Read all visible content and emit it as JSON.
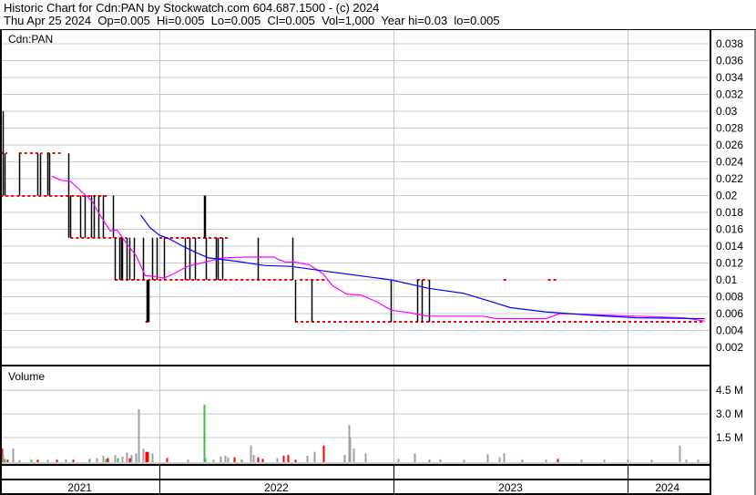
{
  "header": {
    "title": "Historic Chart for Cdn:PAN by Stockwatch.com 604.687.1500 - (c) 2024",
    "quote": "Thu Apr 25 2024  Op=0.005  Hi=0.005  Lo=0.005  Cl=0.005  Vol=1,000  Year hi=0.03  lo=0.005"
  },
  "colors": {
    "bar": "#000000",
    "close": "#ff0000",
    "ma_short": "#ff00ff",
    "ma_long": "#0000ff",
    "vol_up": "#44bb44",
    "vol_down": "#ff0000",
    "vol_flat": "#a0a0a0",
    "grid": "#c8c8c8"
  },
  "chart_data": [
    {
      "type": "line",
      "title": "Cdn:PAN",
      "ylim": [
        0,
        0.04
      ],
      "yticks": [
        "0.002",
        "0.004",
        "0.006",
        "0.008",
        "0.01",
        "0.012",
        "0.014",
        "0.016",
        "0.018",
        "0.02",
        "0.022",
        "0.024",
        "0.026",
        "0.028",
        "0.03",
        "0.032",
        "0.034",
        "0.036",
        "0.038"
      ],
      "xlim": [
        2021.32,
        2024.33
      ],
      "x_labels": [
        {
          "t": 2021.66,
          "label": "2021"
        },
        {
          "t": 2022.5,
          "label": "2022"
        },
        {
          "t": 2023.5,
          "label": "2023"
        },
        {
          "t": 2024.17,
          "label": "2024"
        }
      ],
      "year_boundaries": [
        2022,
        2023,
        2024
      ],
      "hl_bars": [
        [
          2021.33,
          0.02,
          0.03
        ],
        [
          2021.34,
          0.02,
          0.025
        ],
        [
          2021.4,
          0.02,
          0.025
        ],
        [
          2021.48,
          0.02,
          0.025
        ],
        [
          2021.49,
          0.02,
          0.025
        ],
        [
          2021.52,
          0.02,
          0.025
        ],
        [
          2021.53,
          0.02,
          0.025
        ],
        [
          2021.61,
          0.015,
          0.025
        ],
        [
          2021.62,
          0.015,
          0.02
        ],
        [
          2021.66,
          0.015,
          0.02
        ],
        [
          2021.68,
          0.015,
          0.02
        ],
        [
          2021.71,
          0.015,
          0.02
        ],
        [
          2021.72,
          0.015,
          0.02
        ],
        [
          2021.74,
          0.015,
          0.02
        ],
        [
          2021.76,
          0.015,
          0.02
        ],
        [
          2021.8,
          0.015,
          0.02
        ],
        [
          2021.81,
          0.01,
          0.015
        ],
        [
          2021.83,
          0.01,
          0.015
        ],
        [
          2021.835,
          0.01,
          0.015
        ],
        [
          2021.84,
          0.01,
          0.015
        ],
        [
          2021.86,
          0.01,
          0.015
        ],
        [
          2021.87,
          0.01,
          0.015
        ],
        [
          2021.89,
          0.01,
          0.015
        ],
        [
          2021.93,
          0.01,
          0.015
        ],
        [
          2021.945,
          0.005,
          0.01
        ],
        [
          2021.95,
          0.005,
          0.01
        ],
        [
          2021.955,
          0.005,
          0.01
        ],
        [
          2021.97,
          0.01,
          0.015
        ],
        [
          2021.99,
          0.01,
          0.015
        ],
        [
          2022.02,
          0.01,
          0.015
        ],
        [
          2022.11,
          0.01,
          0.015
        ],
        [
          2022.13,
          0.01,
          0.015
        ],
        [
          2022.15,
          0.01,
          0.015
        ],
        [
          2022.19,
          0.015,
          0.02
        ],
        [
          2022.195,
          0.015,
          0.02
        ],
        [
          2022.2,
          0.01,
          0.015
        ],
        [
          2022.24,
          0.01,
          0.015
        ],
        [
          2022.25,
          0.01,
          0.015
        ],
        [
          2022.27,
          0.01,
          0.015
        ],
        [
          2022.42,
          0.01,
          0.015
        ],
        [
          2022.57,
          0.01,
          0.015
        ],
        [
          2022.58,
          0.005,
          0.01
        ],
        [
          2022.65,
          0.005,
          0.01
        ],
        [
          2022.99,
          0.005,
          0.01
        ],
        [
          2023.1,
          0.005,
          0.01
        ],
        [
          2023.12,
          0.005,
          0.01
        ],
        [
          2023.15,
          0.005,
          0.01
        ]
      ],
      "close_runs": [
        [
          2021.32,
          2021.35,
          0.025
        ],
        [
          2021.4,
          2021.5,
          0.025
        ],
        [
          2021.52,
          2021.58,
          0.025
        ],
        [
          2021.32,
          2021.78,
          0.02
        ],
        [
          2021.62,
          2021.86,
          0.015
        ],
        [
          2022.0,
          2022.3,
          0.015
        ],
        [
          2021.81,
          2022.58,
          0.01
        ],
        [
          2022.6,
          2022.72,
          0.01
        ],
        [
          2023.1,
          2023.15,
          0.01
        ],
        [
          2023.47,
          2023.49,
          0.01
        ],
        [
          2023.66,
          2023.7,
          0.01
        ],
        [
          2021.94,
          2021.96,
          0.005
        ],
        [
          2022.58,
          2024.33,
          0.005
        ]
      ],
      "series": [
        {
          "name": "ma_short",
          "points": [
            [
              2021.54,
              0.0223
            ],
            [
              2021.58,
              0.0218
            ],
            [
              2021.62,
              0.0217
            ],
            [
              2021.67,
              0.0204
            ],
            [
              2021.71,
              0.0194
            ],
            [
              2021.75,
              0.0175
            ],
            [
              2021.79,
              0.0158
            ],
            [
              2021.82,
              0.0159
            ],
            [
              2021.86,
              0.0143
            ],
            [
              2021.9,
              0.0129
            ],
            [
              2021.94,
              0.0105
            ],
            [
              2021.98,
              0.0104
            ],
            [
              2022.02,
              0.0102
            ],
            [
              2022.06,
              0.0107
            ],
            [
              2022.12,
              0.0116
            ],
            [
              2022.18,
              0.012
            ],
            [
              2022.21,
              0.0122
            ],
            [
              2022.27,
              0.0126
            ],
            [
              2022.37,
              0.0127
            ],
            [
              2022.49,
              0.0127
            ],
            [
              2022.51,
              0.0124
            ],
            [
              2022.54,
              0.0121
            ],
            [
              2022.58,
              0.0121
            ],
            [
              2022.64,
              0.0118
            ],
            [
              2022.7,
              0.0107
            ],
            [
              2022.74,
              0.0093
            ],
            [
              2022.8,
              0.0083
            ],
            [
              2022.86,
              0.0082
            ],
            [
              2022.93,
              0.0074
            ],
            [
              2022.99,
              0.0064
            ],
            [
              2023.07,
              0.0061
            ],
            [
              2023.15,
              0.0057
            ],
            [
              2023.38,
              0.0057
            ],
            [
              2023.44,
              0.0054
            ],
            [
              2023.65,
              0.0054
            ],
            [
              2023.71,
              0.006
            ],
            [
              2024.04,
              0.0057
            ],
            [
              2024.24,
              0.0055
            ],
            [
              2024.33,
              0.0051
            ]
          ]
        },
        {
          "name": "ma_long",
          "points": [
            [
              2021.92,
              0.0177
            ],
            [
              2021.96,
              0.0162
            ],
            [
              2022.0,
              0.0153
            ],
            [
              2022.04,
              0.0149
            ],
            [
              2022.1,
              0.014
            ],
            [
              2022.16,
              0.0132
            ],
            [
              2022.21,
              0.0126
            ],
            [
              2022.33,
              0.0122
            ],
            [
              2022.45,
              0.0117
            ],
            [
              2022.56,
              0.0116
            ],
            [
              2022.72,
              0.011
            ],
            [
              2022.88,
              0.0104
            ],
            [
              2022.99,
              0.01
            ],
            [
              2023.15,
              0.009
            ],
            [
              2023.3,
              0.0084
            ],
            [
              2023.42,
              0.0074
            ],
            [
              2023.5,
              0.0067
            ],
            [
              2023.65,
              0.0062
            ],
            [
              2023.85,
              0.0058
            ],
            [
              2024.04,
              0.0055
            ],
            [
              2024.33,
              0.0054
            ]
          ]
        }
      ]
    },
    {
      "type": "bar",
      "title": "Volume",
      "ylim": [
        0,
        6
      ],
      "yticks": [
        "1.5 M",
        "3.0 M",
        "4.5 M"
      ],
      "ytick_values": [
        1.5,
        3.0,
        4.5
      ],
      "bars": [
        [
          2021.325,
          0.8,
          "down"
        ],
        [
          2021.33,
          0.4,
          "flat"
        ],
        [
          2021.34,
          0.15,
          "up"
        ],
        [
          2021.35,
          0.1,
          "down"
        ],
        [
          2021.375,
          0.8,
          "flat"
        ],
        [
          2021.4,
          0.08,
          "flat"
        ],
        [
          2021.45,
          0.1,
          "up"
        ],
        [
          2021.48,
          0.1,
          "down"
        ],
        [
          2021.52,
          0.1,
          "flat"
        ],
        [
          2021.56,
          0.1,
          "down"
        ],
        [
          2021.6,
          0.12,
          "flat"
        ],
        [
          2021.63,
          0.1,
          "down"
        ],
        [
          2021.7,
          0.15,
          "up"
        ],
        [
          2021.73,
          0.2,
          "flat"
        ],
        [
          2021.76,
          0.35,
          "flat"
        ],
        [
          2021.77,
          0.15,
          "up"
        ],
        [
          2021.78,
          0.2,
          "down"
        ],
        [
          2021.81,
          0.4,
          "flat"
        ],
        [
          2021.82,
          0.2,
          "up"
        ],
        [
          2021.84,
          0.3,
          "flat"
        ],
        [
          2021.86,
          0.55,
          "flat"
        ],
        [
          2021.87,
          0.2,
          "down"
        ],
        [
          2021.88,
          0.4,
          "flat"
        ],
        [
          2021.9,
          0.5,
          "flat"
        ],
        [
          2021.91,
          3.3,
          "flat"
        ],
        [
          2021.93,
          0.8,
          "flat"
        ],
        [
          2021.94,
          0.6,
          "down"
        ],
        [
          2021.95,
          0.6,
          "down"
        ],
        [
          2021.97,
          0.5,
          "flat"
        ],
        [
          2022.03,
          0.2,
          "down"
        ],
        [
          2022.12,
          0.1,
          "flat"
        ],
        [
          2022.19,
          3.6,
          "up"
        ],
        [
          2022.195,
          0.2,
          "up"
        ],
        [
          2022.23,
          0.1,
          "flat"
        ],
        [
          2022.26,
          0.3,
          "flat"
        ],
        [
          2022.28,
          0.35,
          "flat"
        ],
        [
          2022.29,
          0.25,
          "flat"
        ],
        [
          2022.32,
          0.25,
          "down"
        ],
        [
          2022.35,
          0.1,
          "up"
        ],
        [
          2022.39,
          1.0,
          "flat"
        ],
        [
          2022.4,
          0.4,
          "flat"
        ],
        [
          2022.42,
          0.25,
          "down"
        ],
        [
          2022.44,
          0.15,
          "down"
        ],
        [
          2022.5,
          0.2,
          "flat"
        ],
        [
          2022.53,
          0.35,
          "down"
        ],
        [
          2022.55,
          0.4,
          "down"
        ],
        [
          2022.58,
          0.1,
          "down"
        ],
        [
          2022.63,
          0.35,
          "flat"
        ],
        [
          2022.66,
          0.6,
          "flat"
        ],
        [
          2022.7,
          1.0,
          "down"
        ],
        [
          2022.79,
          0.4,
          "flat"
        ],
        [
          2022.81,
          2.3,
          "flat"
        ],
        [
          2022.815,
          1.5,
          "flat"
        ],
        [
          2022.83,
          0.8,
          "flat"
        ],
        [
          2022.88,
          0.5,
          "flat"
        ],
        [
          2023.02,
          0.15,
          "flat"
        ],
        [
          2023.09,
          0.5,
          "flat"
        ],
        [
          2023.15,
          0.1,
          "up"
        ],
        [
          2023.2,
          0.12,
          "flat"
        ],
        [
          2023.3,
          0.1,
          "flat"
        ],
        [
          2023.4,
          0.45,
          "flat"
        ],
        [
          2023.45,
          0.25,
          "flat"
        ],
        [
          2023.47,
          0.5,
          "flat"
        ],
        [
          2023.55,
          0.1,
          "up"
        ],
        [
          2023.65,
          0.1,
          "flat"
        ],
        [
          2023.7,
          0.15,
          "down"
        ],
        [
          2023.8,
          0.1,
          "flat"
        ],
        [
          2023.9,
          0.1,
          "flat"
        ],
        [
          2024.0,
          0.1,
          "flat"
        ],
        [
          2024.1,
          0.1,
          "flat"
        ],
        [
          2024.22,
          1.0,
          "flat"
        ],
        [
          2024.25,
          0.1,
          "flat"
        ],
        [
          2024.3,
          0.1,
          "flat"
        ]
      ]
    }
  ]
}
